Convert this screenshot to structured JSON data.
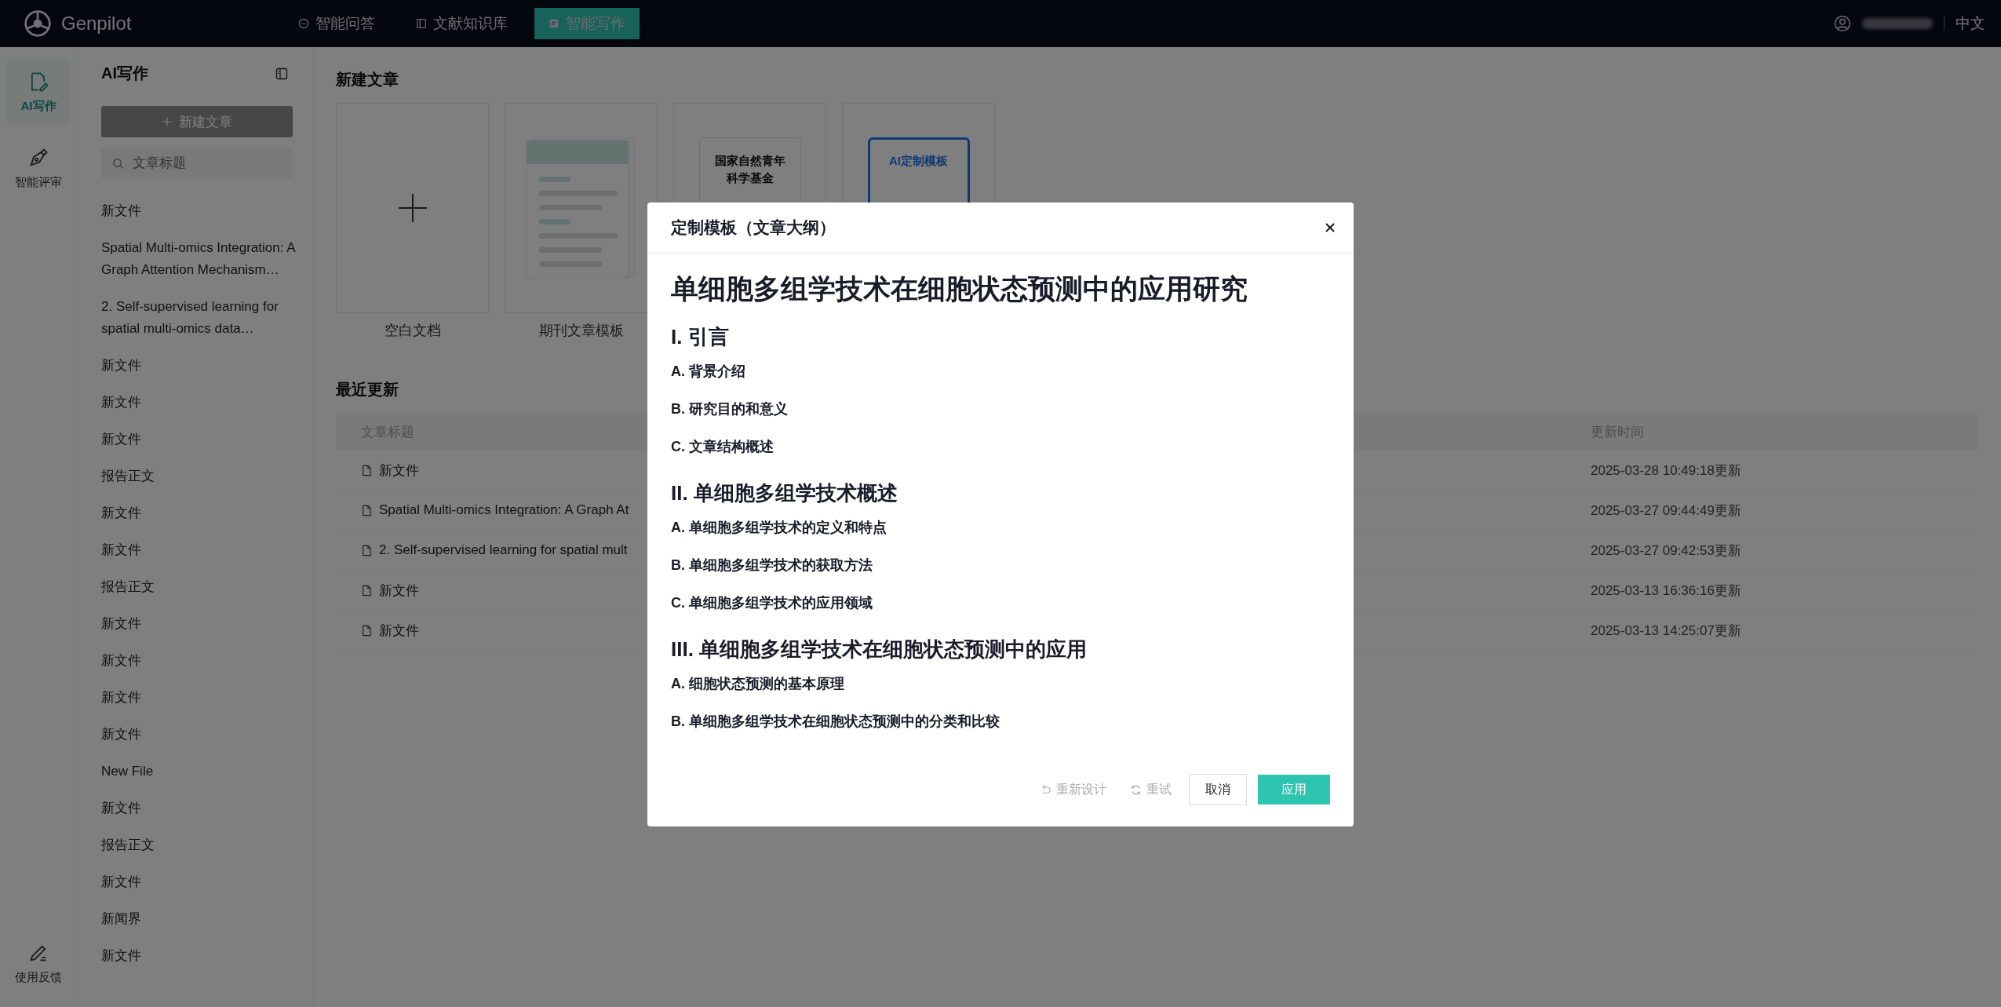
{
  "top_nav": {
    "logo": "Genpilot",
    "tabs": [
      {
        "label": "智能问答",
        "selected": false
      },
      {
        "label": "文献知识库",
        "selected": false
      },
      {
        "label": "智能写作",
        "selected": true
      }
    ],
    "language": "中文"
  },
  "rail": {
    "items": [
      {
        "label": "AI写作",
        "selected": true
      },
      {
        "label": "智能评审",
        "selected": false
      }
    ],
    "feedback": "使用反馈"
  },
  "sidebar": {
    "title": "AI写作",
    "new_button": "新建文章",
    "search_placeholder": "文章标题",
    "files": [
      "新文件",
      "Spatial Multi-omics Integration: A Graph Attention Mechanism…",
      "2. Self-supervised learning for spatial multi-omics data…",
      "新文件",
      "新文件",
      "新文件",
      "报告正文",
      "新文件",
      "新文件",
      "报告正文",
      "新文件",
      "新文件",
      "新文件",
      "新文件",
      "New File",
      "新文件",
      "报告正文",
      "新文件",
      "新闻界",
      "新文件"
    ]
  },
  "main": {
    "new_heading": "新建文章",
    "templates": [
      {
        "kind": "blank",
        "label": "空白文档"
      },
      {
        "kind": "journal",
        "label": "期刊文章模板"
      },
      {
        "kind": "fund",
        "text": "国家自然青年科学基金"
      },
      {
        "kind": "ai",
        "text": "AI定制模板"
      }
    ],
    "recent_heading": "最近更新",
    "table": {
      "columns": [
        "文章标题",
        "更新时间"
      ],
      "rows": [
        {
          "title": "新文件",
          "time": "2025-03-28 10:49:18更新"
        },
        {
          "title": "Spatial Multi-omics Integration: A Graph At",
          "time": "2025-03-27 09:44:49更新"
        },
        {
          "title": "2. Self-supervised learning for spatial mult",
          "time": "2025-03-27 09:42:53更新"
        },
        {
          "title": "新文件",
          "time": "2025-03-13 16:36:16更新"
        },
        {
          "title": "新文件",
          "time": "2025-03-13 14:25:07更新"
        }
      ]
    }
  },
  "dialog": {
    "title": "定制模板（文章大纲）",
    "outline_title": "单细胞多组学技术在细胞状态预测中的应用研究",
    "sections": [
      {
        "heading": "I. 引言",
        "items": [
          "A. 背景介绍",
          "B. 研究目的和意义",
          "C. 文章结构概述"
        ]
      },
      {
        "heading": "II. 单细胞多组学技术概述",
        "items": [
          "A. 单细胞多组学技术的定义和特点",
          "B. 单细胞多组学技术的获取方法",
          "C. 单细胞多组学技术的应用领域"
        ]
      },
      {
        "heading": "III. 单细胞多组学技术在细胞状态预测中的应用",
        "items": [
          "A. 细胞状态预测的基本原理",
          "B. 单细胞多组学技术在细胞状态预测中的分类和比较"
        ]
      }
    ],
    "buttons": [
      {
        "kind": "redesign",
        "label": "重新设计"
      },
      {
        "kind": "retry",
        "label": "重试"
      },
      {
        "kind": "cancel",
        "label": "取消"
      },
      {
        "kind": "apply",
        "label": "应用"
      }
    ]
  }
}
